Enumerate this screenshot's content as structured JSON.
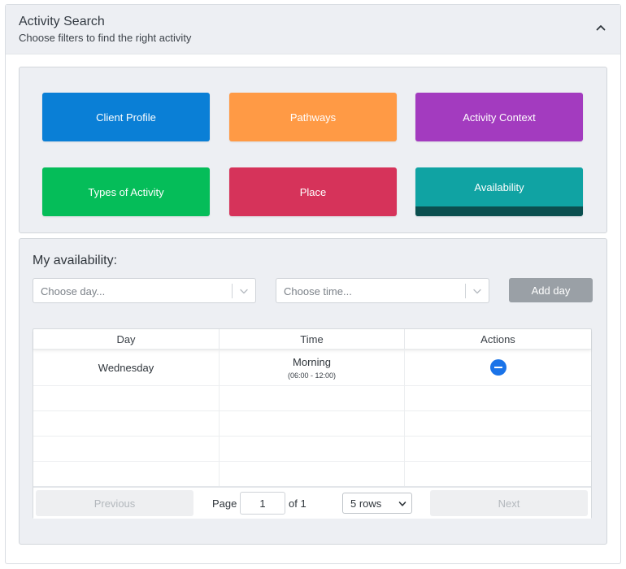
{
  "header": {
    "title": "Activity Search",
    "subtitle": "Choose filters to find the right activity",
    "collapse_icon": "chevron-up-icon"
  },
  "filters": [
    {
      "label": "Client Profile",
      "color": "#0a7fd6"
    },
    {
      "label": "Pathways",
      "color": "#ff9a45"
    },
    {
      "label": "Activity Context",
      "color": "#a33bbf"
    },
    {
      "label": "Types of Activity",
      "color": "#05bd59"
    },
    {
      "label": "Place",
      "color": "#d6335a"
    },
    {
      "label": "Availability",
      "color": "#10a3a3",
      "active": true,
      "active_bar_color": "#0b4f4f"
    }
  ],
  "availability": {
    "title": "My availability:",
    "day_select": {
      "placeholder": "Choose day..."
    },
    "time_select": {
      "placeholder": "Choose time..."
    },
    "add_button": "Add day"
  },
  "table": {
    "columns": [
      "Day",
      "Time",
      "Actions"
    ],
    "rows": [
      {
        "day": "Wednesday",
        "time": "Morning",
        "time_range": "(06:00 - 12:00)",
        "action_icon": "minus-circle-icon"
      }
    ],
    "empty_rows": 4,
    "pagination": {
      "previous": "Previous",
      "next": "Next",
      "page_label": "Page",
      "page_value": "1",
      "of_label": "of 1",
      "rows_selected": "5 rows"
    }
  }
}
